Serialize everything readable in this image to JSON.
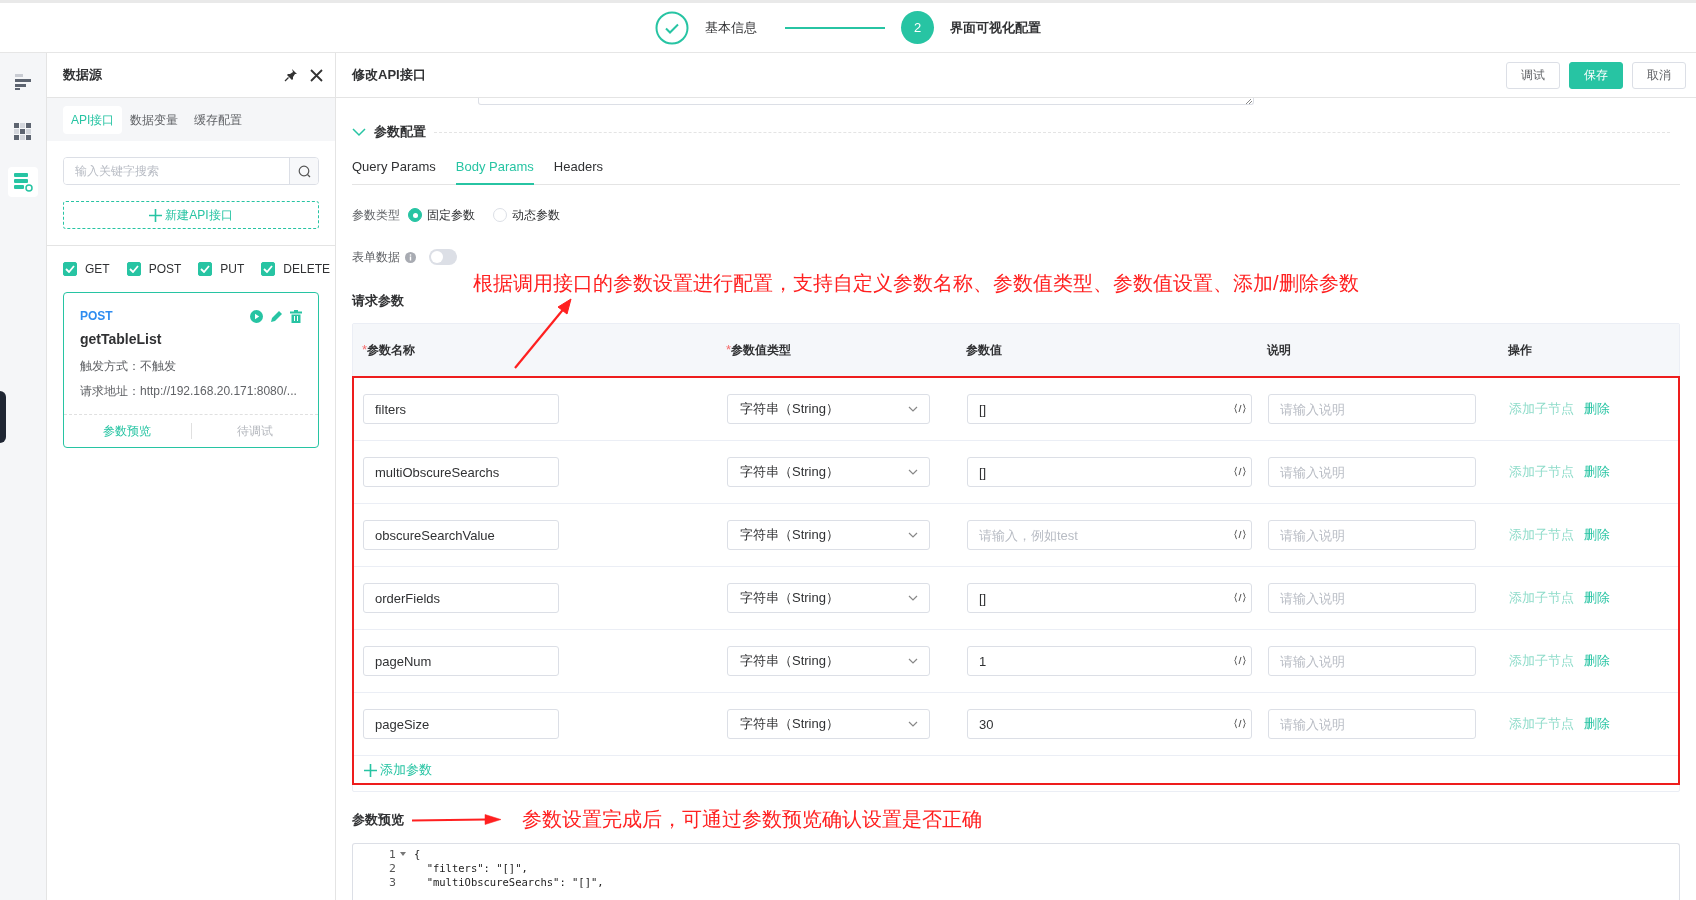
{
  "stepper": {
    "steps": [
      {
        "label": "基本信息",
        "done": true,
        "selected": false
      },
      {
        "label": "界面可视化配置",
        "number": "2",
        "done": false,
        "selected": true
      }
    ]
  },
  "rail": {
    "items": [
      {
        "kind": "outline",
        "selected": false
      },
      {
        "kind": "grid",
        "selected": false
      },
      {
        "kind": "datasource",
        "selected": true
      }
    ]
  },
  "datasource": {
    "title": "数据源",
    "tabs": [
      {
        "label": "API接口",
        "selected": true
      },
      {
        "label": "数据变量",
        "selected": false
      },
      {
        "label": "缓存配置",
        "selected": false
      }
    ],
    "search": {
      "placeholder": "输入关键字搜索"
    },
    "new_button": "新建API接口",
    "filters": [
      {
        "label": "GET",
        "checked": true
      },
      {
        "label": "POST",
        "checked": true
      },
      {
        "label": "PUT",
        "checked": true
      },
      {
        "label": "DELETE",
        "checked": true
      }
    ],
    "cards": [
      {
        "method": "POST",
        "name": "getTableList",
        "trigger": "触发方式：不触发",
        "url": "请求地址：http://192.168.20.171:8080/...",
        "selected": true,
        "actions": [
          {
            "label": "参数预览",
            "disabled": false
          },
          {
            "label": "待调试",
            "disabled": true
          }
        ]
      }
    ]
  },
  "editor": {
    "title": "修改API接口",
    "buttons": [
      {
        "label": "调试",
        "kind": "default"
      },
      {
        "label": "保存",
        "kind": "primary"
      },
      {
        "label": "取消",
        "kind": "default"
      }
    ],
    "section": {
      "title": "参数配置",
      "expanded": true
    },
    "tabs": [
      {
        "label": "Query Params",
        "selected": false
      },
      {
        "label": "Body Params",
        "selected": true
      },
      {
        "label": "Headers",
        "selected": false
      }
    ],
    "param_type": {
      "label": "参数类型",
      "options": [
        {
          "label": "固定参数",
          "selected": true
        },
        {
          "label": "动态参数",
          "selected": false
        }
      ]
    },
    "form_data": {
      "label": "表单数据",
      "on": false
    },
    "request_params": {
      "title": "请求参数",
      "annotation": "根据调用接口的参数设置进行配置，支持自定义参数名称、参数值类型、参数值设置、添加/删除参数",
      "columns": [
        {
          "label": "参数名称",
          "required_mark": "*"
        },
        {
          "label": "参数值类型",
          "required_mark": "*"
        },
        {
          "label": "参数值"
        },
        {
          "label": "说明"
        },
        {
          "label": "操作"
        }
      ],
      "rows": [
        {
          "name": "filters",
          "type": "字符串（String）",
          "value": "[]",
          "description_placeholder": "请输入说明",
          "actions": [
            {
              "label": "添加子节点",
              "disabled": true
            },
            {
              "label": "删除",
              "disabled": false
            }
          ]
        },
        {
          "name": "multiObscureSearchs",
          "type": "字符串（String）",
          "value": "[]",
          "description_placeholder": "请输入说明",
          "actions": [
            {
              "label": "添加子节点",
              "disabled": true
            },
            {
              "label": "删除",
              "disabled": false
            }
          ]
        },
        {
          "name": "obscureSearchValue",
          "type": "字符串（String）",
          "value_placeholder": "请输入，例如test",
          "description_placeholder": "请输入说明",
          "actions": [
            {
              "label": "添加子节点",
              "disabled": true
            },
            {
              "label": "删除",
              "disabled": false
            }
          ]
        },
        {
          "name": "orderFields",
          "type": "字符串（String）",
          "value": "[]",
          "description_placeholder": "请输入说明",
          "actions": [
            {
              "label": "添加子节点",
              "disabled": true
            },
            {
              "label": "删除",
              "disabled": false
            }
          ]
        },
        {
          "name": "pageNum",
          "type": "字符串（String）",
          "value": "1",
          "description_placeholder": "请输入说明",
          "actions": [
            {
              "label": "添加子节点",
              "disabled": true
            },
            {
              "label": "删除",
              "disabled": false
            }
          ]
        },
        {
          "name": "pageSize",
          "type": "字符串（String）",
          "value": "30",
          "description_placeholder": "请输入说明",
          "actions": [
            {
              "label": "添加子节点",
              "disabled": true
            },
            {
              "label": "删除",
              "disabled": false
            }
          ]
        }
      ],
      "add_button": "添加参数"
    },
    "preview": {
      "title": "参数预览",
      "annotation": "参数设置完成后，可通过参数预览确认设置是否正确",
      "lines": [
        {
          "number": "1",
          "text": "{",
          "foldable": true
        },
        {
          "number": "2",
          "text": "  \"filters\": \"[]\",",
          "foldable": false
        },
        {
          "number": "3",
          "text": "  \"multiObscureSearchs\": \"[]\",",
          "foldable": false
        }
      ]
    }
  }
}
